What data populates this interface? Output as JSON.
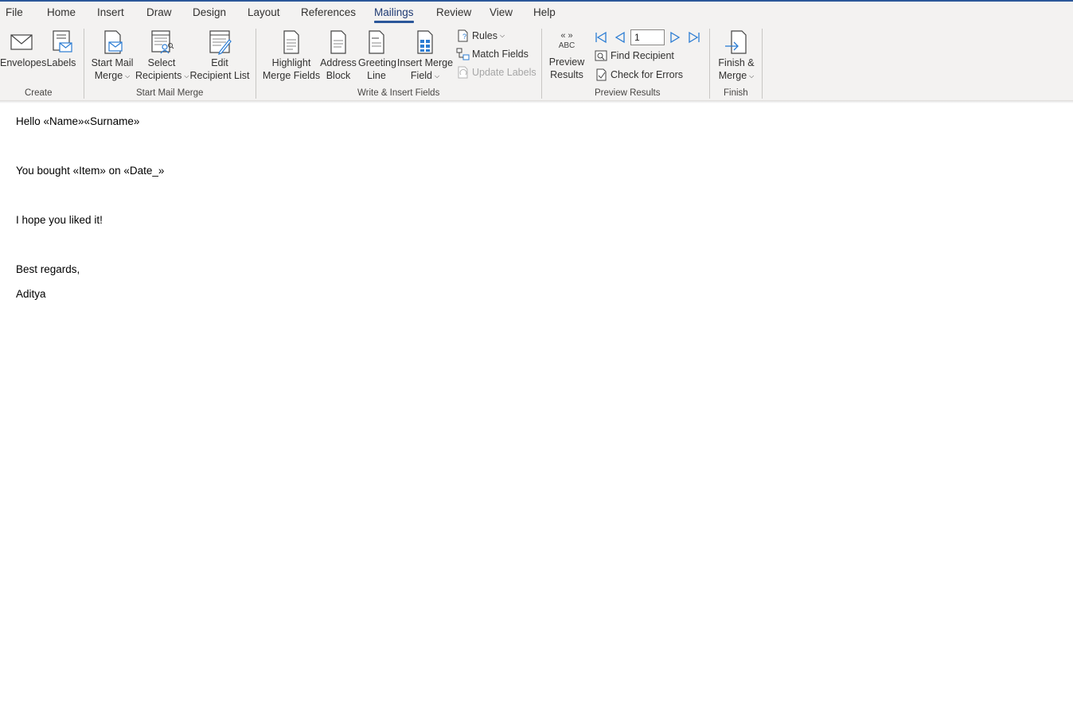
{
  "tabs": [
    "File",
    "Home",
    "Insert",
    "Draw",
    "Design",
    "Layout",
    "References",
    "Mailings",
    "Review",
    "View",
    "Help"
  ],
  "active_tab": "Mailings",
  "ribbon": {
    "create": {
      "label": "Create",
      "envelopes": "Envelopes",
      "labels": "Labels"
    },
    "start_mail_merge": {
      "label": "Start Mail Merge",
      "start_l1": "Start Mail",
      "start_l2": "Merge",
      "select_l1": "Select",
      "select_l2": "Recipients",
      "edit_l1": "Edit",
      "edit_l2": "Recipient List"
    },
    "write_insert": {
      "label": "Write & Insert Fields",
      "highlight_l1": "Highlight",
      "highlight_l2": "Merge Fields",
      "address_l1": "Address",
      "address_l2": "Block",
      "greeting_l1": "Greeting",
      "greeting_l2": "Line",
      "insert_l1": "Insert Merge",
      "insert_l2": "Field",
      "rules": "Rules",
      "match_fields": "Match Fields",
      "update_labels": "Update Labels"
    },
    "preview": {
      "label": "Preview Results",
      "abc_top": "«  »",
      "abc": "ABC",
      "preview_l1": "Preview",
      "preview_l2": "Results",
      "record": "1",
      "find_recipient": "Find Recipient",
      "check_errors": "Check for Errors"
    },
    "finish": {
      "label": "Finish",
      "finish_l1": "Finish &",
      "finish_l2": "Merge"
    }
  },
  "document": {
    "line1": "Hello «Name»«Surname»",
    "line2": "You bought «Item» on «Date_»",
    "line3": "I hope you liked it!",
    "line4": "Best regards,",
    "line5": "Aditya"
  },
  "colors": {
    "accent": "#2b579a",
    "icon_blue": "#2b7cd3",
    "ribbon_bg": "#f3f2f1"
  }
}
